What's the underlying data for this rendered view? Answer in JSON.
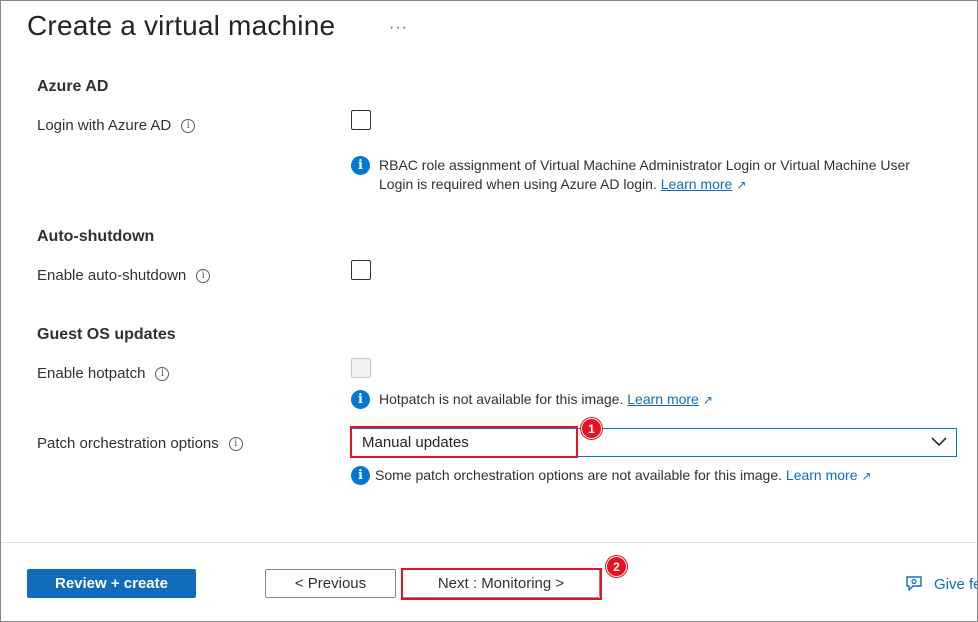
{
  "header": {
    "title": "Create a virtual machine",
    "more_label": "···"
  },
  "sections": {
    "azure_ad": {
      "heading": "Azure AD",
      "login_label": "Login with Azure AD",
      "login_checked": false,
      "info_text": "RBAC role assignment of Virtual Machine Administrator Login or Virtual Machine User Login is required when using Azure AD login.",
      "info_link": "Learn more"
    },
    "auto_shutdown": {
      "heading": "Auto-shutdown",
      "enable_label": "Enable auto-shutdown",
      "enable_checked": false
    },
    "guest_os": {
      "heading": "Guest OS updates",
      "hotpatch_label": "Enable hotpatch",
      "hotpatch_checked": false,
      "hotpatch_disabled": true,
      "hotpatch_info": "Hotpatch is not available for this image.",
      "hotpatch_link": "Learn more",
      "patch_label": "Patch orchestration options",
      "patch_value": "Manual updates",
      "patch_info": "Some patch orchestration options are not available for this image.",
      "patch_link": "Learn more"
    }
  },
  "annotations": {
    "badge_1": "1",
    "badge_2": "2",
    "highlight_color": "#e81123"
  },
  "footer": {
    "review_create": "Review + create",
    "previous": "< Previous",
    "next": "Next : Monitoring >",
    "feedback": "Give fe"
  },
  "colors": {
    "accent": "#0f6cbd",
    "info_icon": "#0078d4"
  }
}
